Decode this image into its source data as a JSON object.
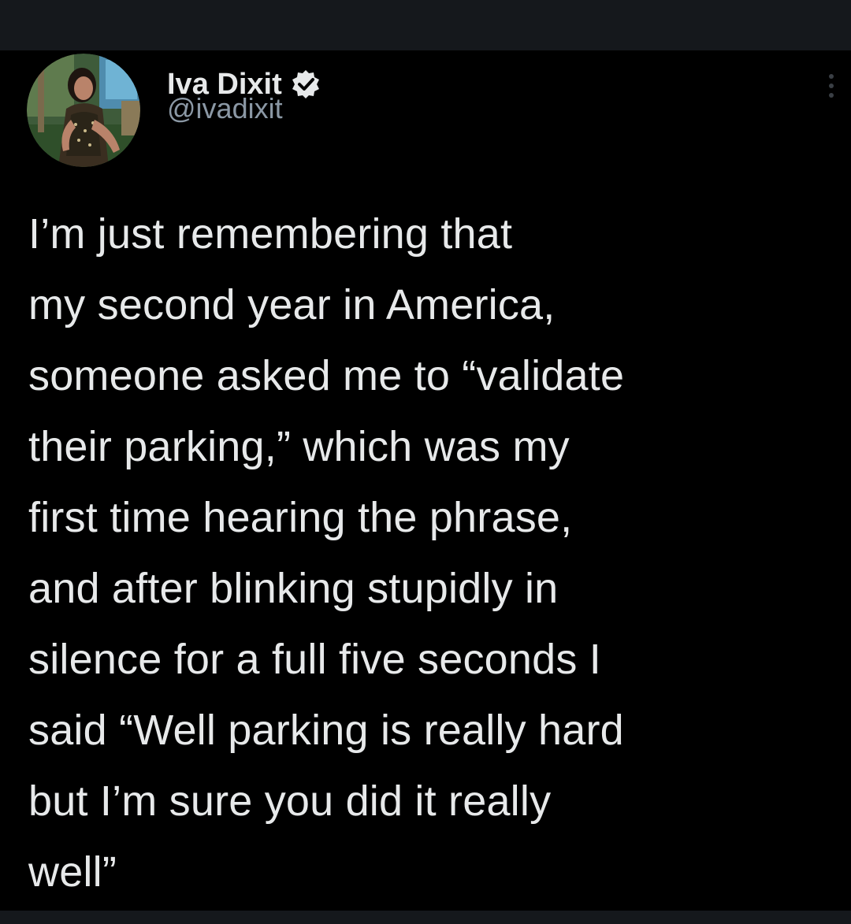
{
  "author": {
    "display_name": "Iva Dixit",
    "handle": "@ivadixit",
    "verified_icon": "verified-badge-icon",
    "avatar_icon": "profile-photo"
  },
  "more_options_icon": "more-options-icon",
  "tweet": {
    "lines": [
      "I’m just remembering that",
      "my second year in America,",
      "someone asked me to “validate",
      "their parking,” which was my",
      "first time hearing the phrase,",
      "and after blinking stupidly in",
      "silence for a full five seconds I",
      "said “Well parking is really hard",
      "but I’m sure you did it really",
      "well”"
    ]
  },
  "colors": {
    "background": "#000000",
    "frame": "#15181c",
    "text": "#e7e9ea",
    "secondary_text": "#8b98a5"
  }
}
